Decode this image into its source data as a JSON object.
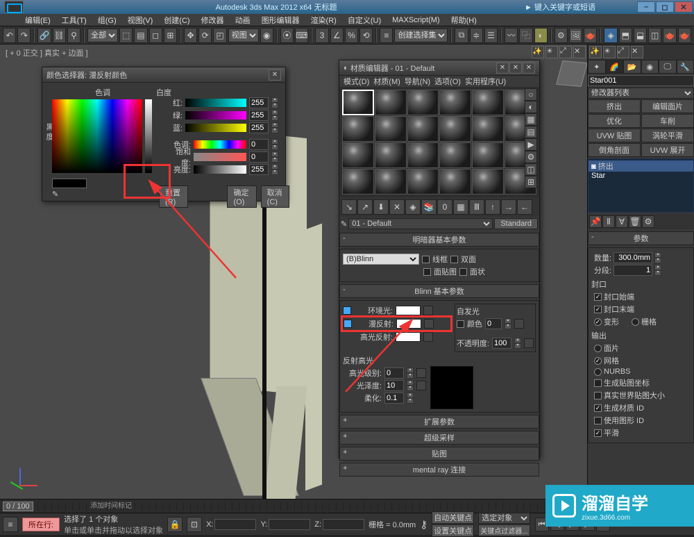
{
  "title": "Autodesk 3ds Max  2012 x64    无标题",
  "menus": [
    "编辑(E)",
    "工具(T)",
    "组(G)",
    "视图(V)",
    "创建(C)",
    "修改器",
    "动画",
    "图形编辑器",
    "渲染(R)",
    "自定义(U)",
    "MAXScript(M)",
    "帮助(H)"
  ],
  "toolbar_select": "全部",
  "selset": "创建选择集",
  "viewport_label": "[ + 0 正交 ] 真实 + 边面 ]",
  "color_dlg": {
    "title": "颜色选择器: 漫反射颜色",
    "hue": "色调",
    "whiteness": "白度",
    "blackness": "黑 度",
    "r": "红:",
    "g": "绿:",
    "b": "蓝:",
    "h": "色调:",
    "s": "饱和度:",
    "v": "亮度:",
    "rv": "255",
    "gv": "255",
    "bv": "255",
    "hv": "0",
    "sv": "0",
    "vv": "255",
    "reset": "重置(R)",
    "ok": "确定(O)",
    "cancel": "取消(C)"
  },
  "mat_dlg": {
    "title": "材质编辑器 - 01 - Default",
    "menus": [
      "模式(D)",
      "材质(M)",
      "导航(N)",
      "选项(O)",
      "实用程序(U)"
    ],
    "name": "01 - Default",
    "type": "Standard",
    "roll1": "明暗器基本参数",
    "shader": "(B)Blinn",
    "wire": "线框",
    "twoSided": "双面",
    "faceMap": "面贴图",
    "faceted": "面状",
    "roll2": "Blinn 基本参数",
    "ambient": "环境光:",
    "diffuse": "漫反射:",
    "specCol": "高光反射:",
    "selfIllum": "自发光",
    "colorCb": "颜色",
    "opacity": "不透明度:",
    "opVal": "100",
    "siVal": "0",
    "specHd": "反射高光",
    "specLvl": "高光级别:",
    "gloss": "光泽度:",
    "soften": "柔化:",
    "slv": "0",
    "glv": "10",
    "sov": "0.1",
    "roll3": "扩展参数",
    "roll4": "超级采样",
    "roll5": "贴图",
    "roll6": "mental ray 连接"
  },
  "cmd": {
    "objName": "Star001",
    "modList": "修改器列表",
    "btns": [
      "挤出",
      "编辑面片",
      "优化",
      "车削",
      "UVW 贴图",
      "涡轮平滑",
      "倒角剖面",
      "UVW 展开"
    ],
    "stack": [
      "挤出",
      "Star"
    ],
    "paramHd": "参数",
    "amount": "数量:",
    "amountV": "300.0mm",
    "segments": "分段:",
    "segV": "1",
    "capHd": "封口",
    "capStart": "封口始端",
    "capEnd": "封口末端",
    "morph": "变形",
    "grid": "栅格",
    "outHd": "输出",
    "patch": "面片",
    "mesh": "网格",
    "nurbs": "NURBS",
    "genMap": "生成贴图坐标",
    "realWorld": "真实世界贴图大小",
    "genMat": "生成材质 ID",
    "useShape": "使用图形 ID",
    "smooth": "平滑"
  },
  "time": {
    "range": "0 / 100"
  },
  "status": {
    "sel": "选择了 1 个对象",
    "hint": "单击或单击并拖动以选择对象",
    "grid": "栅格 = 0.0mm",
    "autokey": "自动关键点",
    "selLock": "选定对象",
    "setkey": "设置关键点",
    "filter": "关键点过滤器...",
    "add": "添加时间标记",
    "inBtn": "所在行:"
  },
  "wm": {
    "name": "溜溜自学",
    "url": "zixue.3d66.com"
  }
}
